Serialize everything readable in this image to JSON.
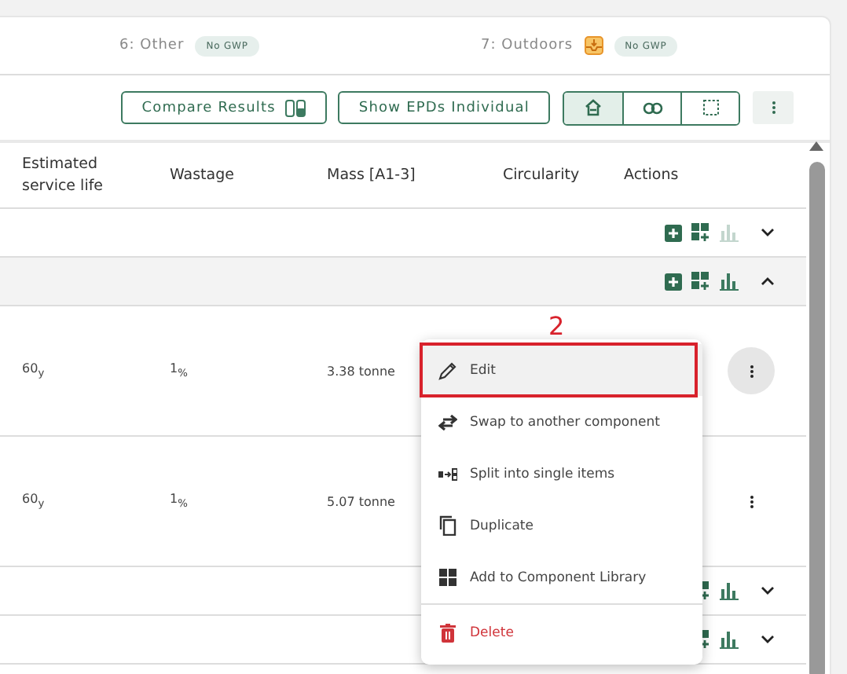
{
  "categories": [
    {
      "label": "6: Other",
      "icon": false,
      "badge": "No GWP"
    },
    {
      "label": "7: Outdoors",
      "icon": true,
      "badge": "No GWP"
    }
  ],
  "toolbar": {
    "buttons": [
      {
        "label": "Compare Results",
        "kind": "compare"
      },
      {
        "label": "Show EPDs Individual",
        "kind": "plain"
      }
    ],
    "view_toggle": [
      {
        "kind": "house",
        "selected": true
      },
      {
        "kind": "link",
        "selected": false
      },
      {
        "kind": "frame",
        "selected": false
      }
    ]
  },
  "table": {
    "columns": [
      "Estimated service life",
      "Wastage",
      "Mass [A1-3]",
      "Circularity",
      "Actions"
    ],
    "rows": [
      {
        "kind": "group",
        "expanded": false,
        "chart_enabled": false
      },
      {
        "kind": "group",
        "expanded": true,
        "chart_enabled": true
      },
      {
        "kind": "item",
        "service_life": "60$_{y}$",
        "wastage": "1$_{%}$",
        "mass": "3.38 tonne",
        "menu_open": true
      },
      {
        "kind": "item",
        "service_life": "60$_{y}$",
        "wastage": "1$_{%}$",
        "mass": "5.07 tonne",
        "menu_open": false
      },
      {
        "kind": "group",
        "expanded": false,
        "chart_enabled": true
      },
      {
        "kind": "group",
        "expanded": false,
        "chart_enabled": true
      }
    ]
  },
  "context_menu": {
    "items": [
      {
        "label": "Edit",
        "selected": true,
        "danger": false
      },
      {
        "label": "Swap to another component",
        "selected": false,
        "danger": false
      },
      {
        "label": "Split into single items",
        "selected": false,
        "danger": false
      },
      {
        "label": "Duplicate",
        "selected": false,
        "danger": false
      },
      {
        "label": "Add to Component Library",
        "selected": false,
        "danger": false
      },
      {
        "label": "Delete",
        "selected": false,
        "danger": true
      }
    ]
  },
  "annotation": {
    "label": "2"
  }
}
